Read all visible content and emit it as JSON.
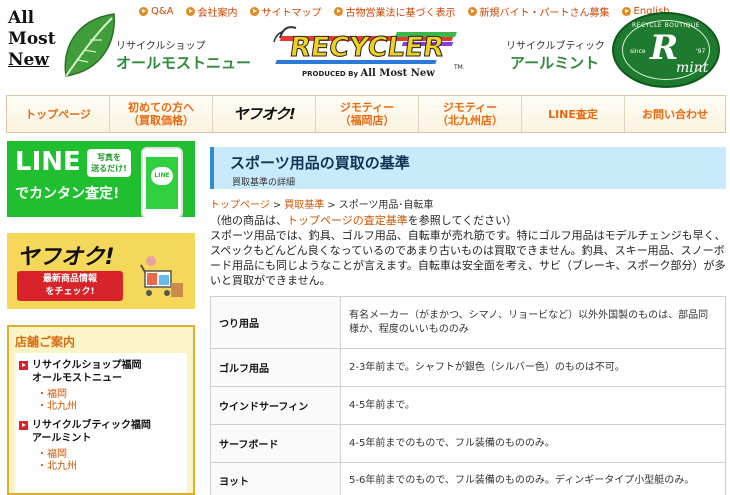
{
  "header": {
    "logo_lines": [
      "All",
      "Most",
      "New"
    ],
    "shop_small": "リサイクルショップ",
    "shop_big": "オールモストニュー",
    "top_links": [
      "Q&A",
      "会社案内",
      "サイトマップ",
      "古物営業法に基づく表示",
      "新規バイト・パートさん募集",
      "English"
    ],
    "recycler_word": "RECYCLER",
    "produced_by": "PRODUCED By",
    "produced_brand": "All Most New",
    "tm": "TM.",
    "mint_small": "リサイクルブティック",
    "mint_big": "アールミント",
    "mint_badge": {
      "top": "RECYCLE BOUTIQUE",
      "letter": "R",
      "word": "mint",
      "since": "since",
      "year": "'97"
    }
  },
  "nav": {
    "items": [
      {
        "label": "トップページ"
      },
      {
        "label": "初めての方へ\n（買取価格）"
      },
      {
        "label": "ヤフオク!"
      },
      {
        "label": "ジモティー\n（福岡店）"
      },
      {
        "label": "ジモティー\n（北九州店）"
      },
      {
        "label": "LINE査定"
      },
      {
        "label": "お問い合わせ"
      }
    ]
  },
  "sidebar": {
    "line_banner": {
      "title": "LINE",
      "subtitle": "でカンタン査定!",
      "bubble": "写真を\n送るだけ!",
      "app": "LINE"
    },
    "yahoo_banner": {
      "title": "ヤフオク!",
      "subtitle": "最新商品情報\nをチェック!"
    },
    "stores": {
      "title": "店舗ご案内",
      "entries": [
        {
          "name": "リサイクルショップ福岡\nオールモストニュー",
          "branches": [
            "福岡",
            "北九州"
          ]
        },
        {
          "name": "リサイクルブティック福岡\nアールミント",
          "branches": [
            "福岡",
            "北九州"
          ]
        }
      ]
    }
  },
  "main": {
    "heading": "スポーツ用品の買取の基準",
    "subheading": "買取基準の詳細",
    "breadcrumb": [
      "トップページ",
      "買取基準",
      "スポーツ用品･自転車"
    ],
    "intro_prefix": "（他の商品は、",
    "intro_link": "トップページの査定基準",
    "intro_suffix": "を参照してください）",
    "intro_body": "スポーツ用品では、釣具、ゴルフ用品、自転車が売れ筋です。特にゴルフ用品はモデルチェンジも早く、スペックもどんどん良くなっているのであまり古いものは買取できません。釣具、スキー用品、スノーボード用品にも同じようなことが言えます。自転車は安全面を考え、サビ（ブレーキ、スポーク部分）が多いと買取ができません。",
    "table": [
      {
        "category": "つり用品",
        "desc": "有名メーカー（がまかつ、シマノ、リョービなど）以外外国製のものは、部品同様か、程度のいいもののみ"
      },
      {
        "category": "ゴルフ用品",
        "desc": "2-3年前まで。シャフトが銀色（シルバー色）のものは不可。"
      },
      {
        "category": "ウインドサーフィン",
        "desc": "4-5年前まで。"
      },
      {
        "category": "サーフボード",
        "desc": "4-5年前までのもので、フル装備のもののみ。"
      },
      {
        "category": "ヨット",
        "desc": "5-6年前までのもので、フル装備のもののみ。ディンギータイプ小型艇のみ。"
      }
    ]
  }
}
